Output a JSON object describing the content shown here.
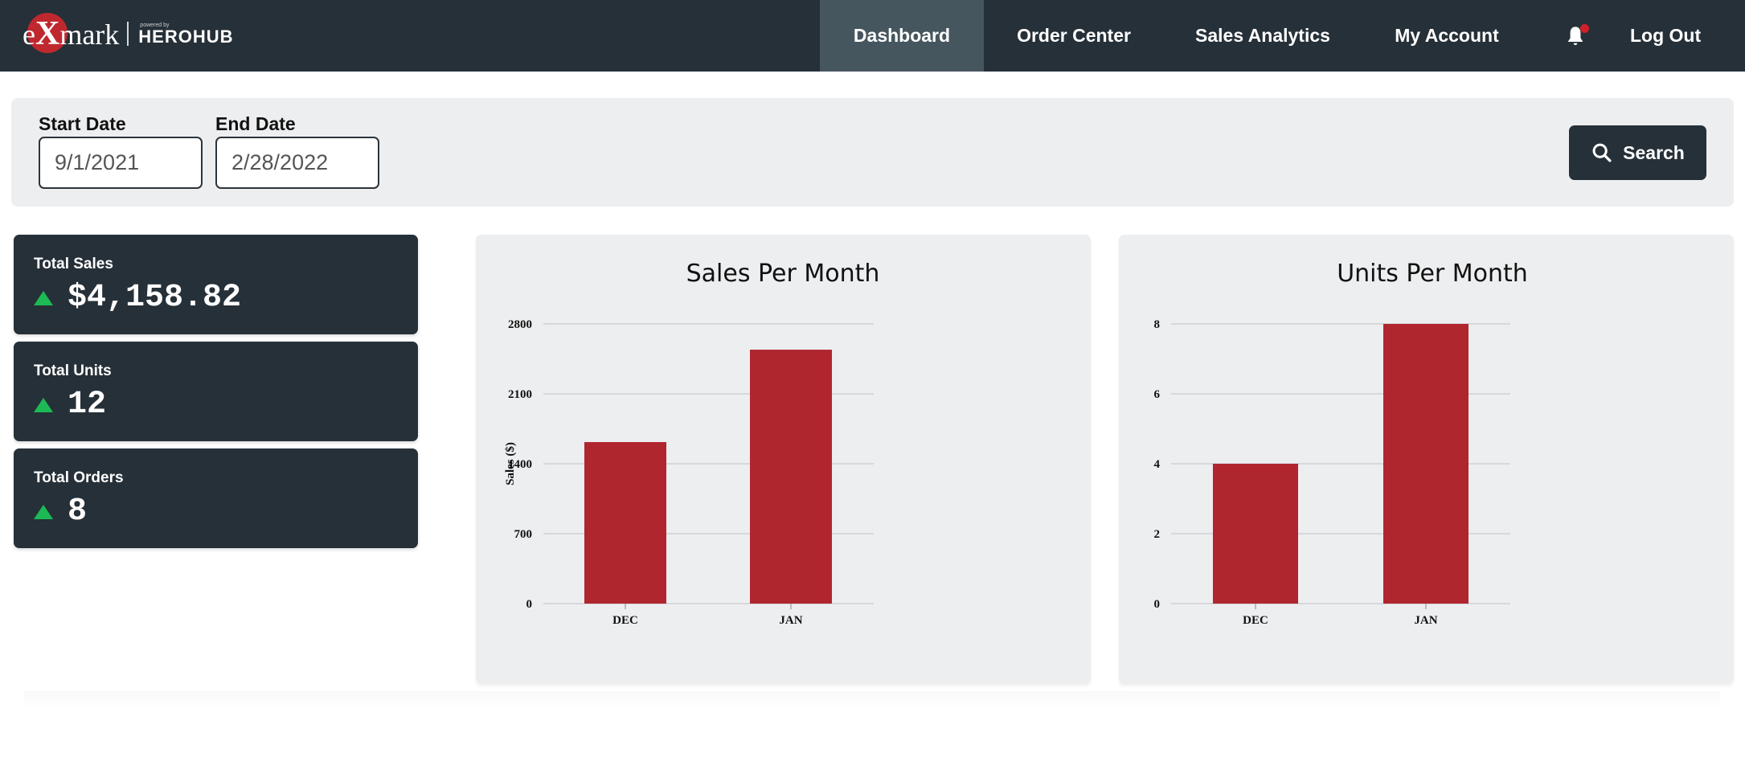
{
  "brand": {
    "logo_text_pre": "e",
    "logo_text_x": "X",
    "logo_text_post": "mark",
    "powered_by": "powered by",
    "partner": "HEROHUB"
  },
  "nav": {
    "items": [
      {
        "label": "Dashboard",
        "active": true
      },
      {
        "label": "Order Center",
        "active": false
      },
      {
        "label": "Sales Analytics",
        "active": false
      },
      {
        "label": "My Account",
        "active": false
      }
    ],
    "bell_icon": "bell-icon",
    "bell_has_notification": true,
    "logout_label": "Log Out"
  },
  "filters": {
    "start_date": {
      "label": "Start Date",
      "value": "9/1/2021"
    },
    "end_date": {
      "label": "End Date",
      "value": "2/28/2022"
    },
    "search_label": "Search",
    "search_icon": "search-icon"
  },
  "stats": [
    {
      "label": "Total Sales",
      "value": "$4,158.82",
      "trend": "up"
    },
    {
      "label": "Total Units",
      "value": "12",
      "trend": "up"
    },
    {
      "label": "Total Orders",
      "value": "8",
      "trend": "up"
    }
  ],
  "colors": {
    "nav_bg": "#263038",
    "nav_active": "#46565f",
    "bar": "#b0262f",
    "trend_up": "#1db954",
    "panel_bg": "#edeef0",
    "notification_dot": "#d0202a"
  },
  "chart_data": [
    {
      "type": "bar",
      "title": "Sales Per Month",
      "categories": [
        "DEC",
        "JAN"
      ],
      "values": [
        1617,
        2542
      ],
      "xlabel": "",
      "ylabel": "Sales ($)",
      "ylim": [
        0,
        2800
      ],
      "yticks": [
        0,
        700,
        1400,
        2100,
        2800
      ],
      "grid": true,
      "legend": "none"
    },
    {
      "type": "bar",
      "title": "Units Per Month",
      "categories": [
        "DEC",
        "JAN"
      ],
      "values": [
        4,
        8
      ],
      "xlabel": "",
      "ylabel": "",
      "ylim": [
        0,
        8
      ],
      "yticks": [
        0,
        2,
        4,
        6,
        8
      ],
      "grid": true,
      "legend": "none"
    }
  ]
}
